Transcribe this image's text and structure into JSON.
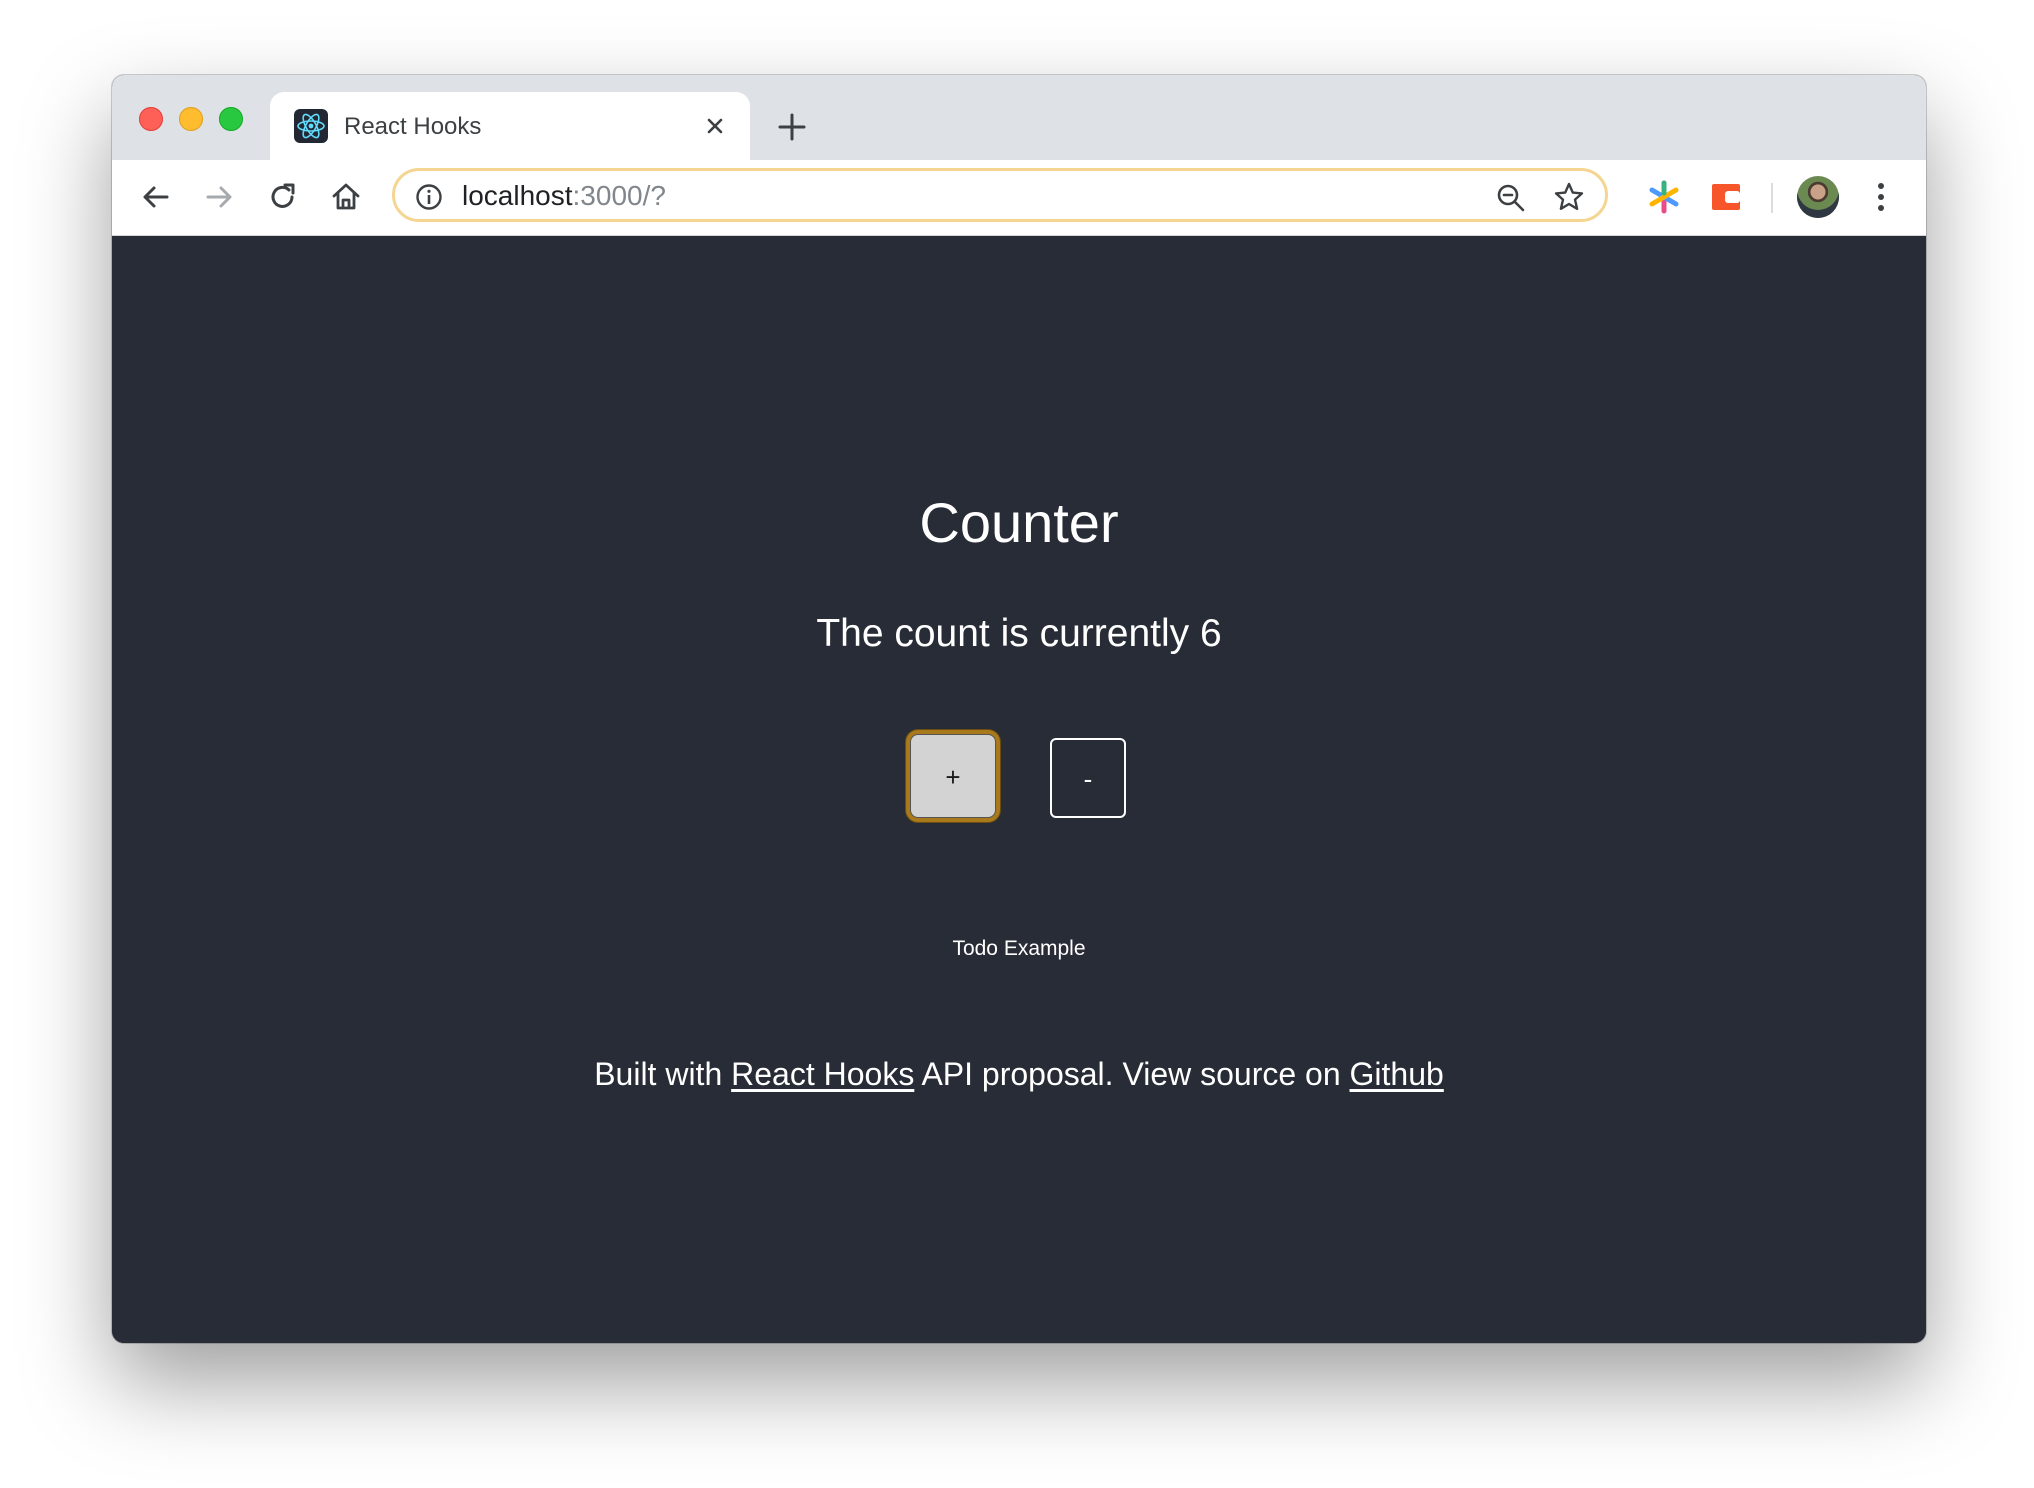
{
  "browser": {
    "tab": {
      "title": "React Hooks",
      "favicon": "react-logo-icon"
    },
    "address_bar": {
      "host": "localhost",
      "path": ":3000/?"
    },
    "omnibox_border_color": "#f5d592"
  },
  "page": {
    "background": "#282c36",
    "heading": "Counter",
    "count_label": "The count is currently 6",
    "increment_label": "+",
    "decrement_label": "-",
    "todo_link": "Todo Example",
    "footer": {
      "prefix": "Built with ",
      "react_hooks_link": "React Hooks",
      "middle": " API proposal. View source on ",
      "github_link": "Github"
    }
  }
}
